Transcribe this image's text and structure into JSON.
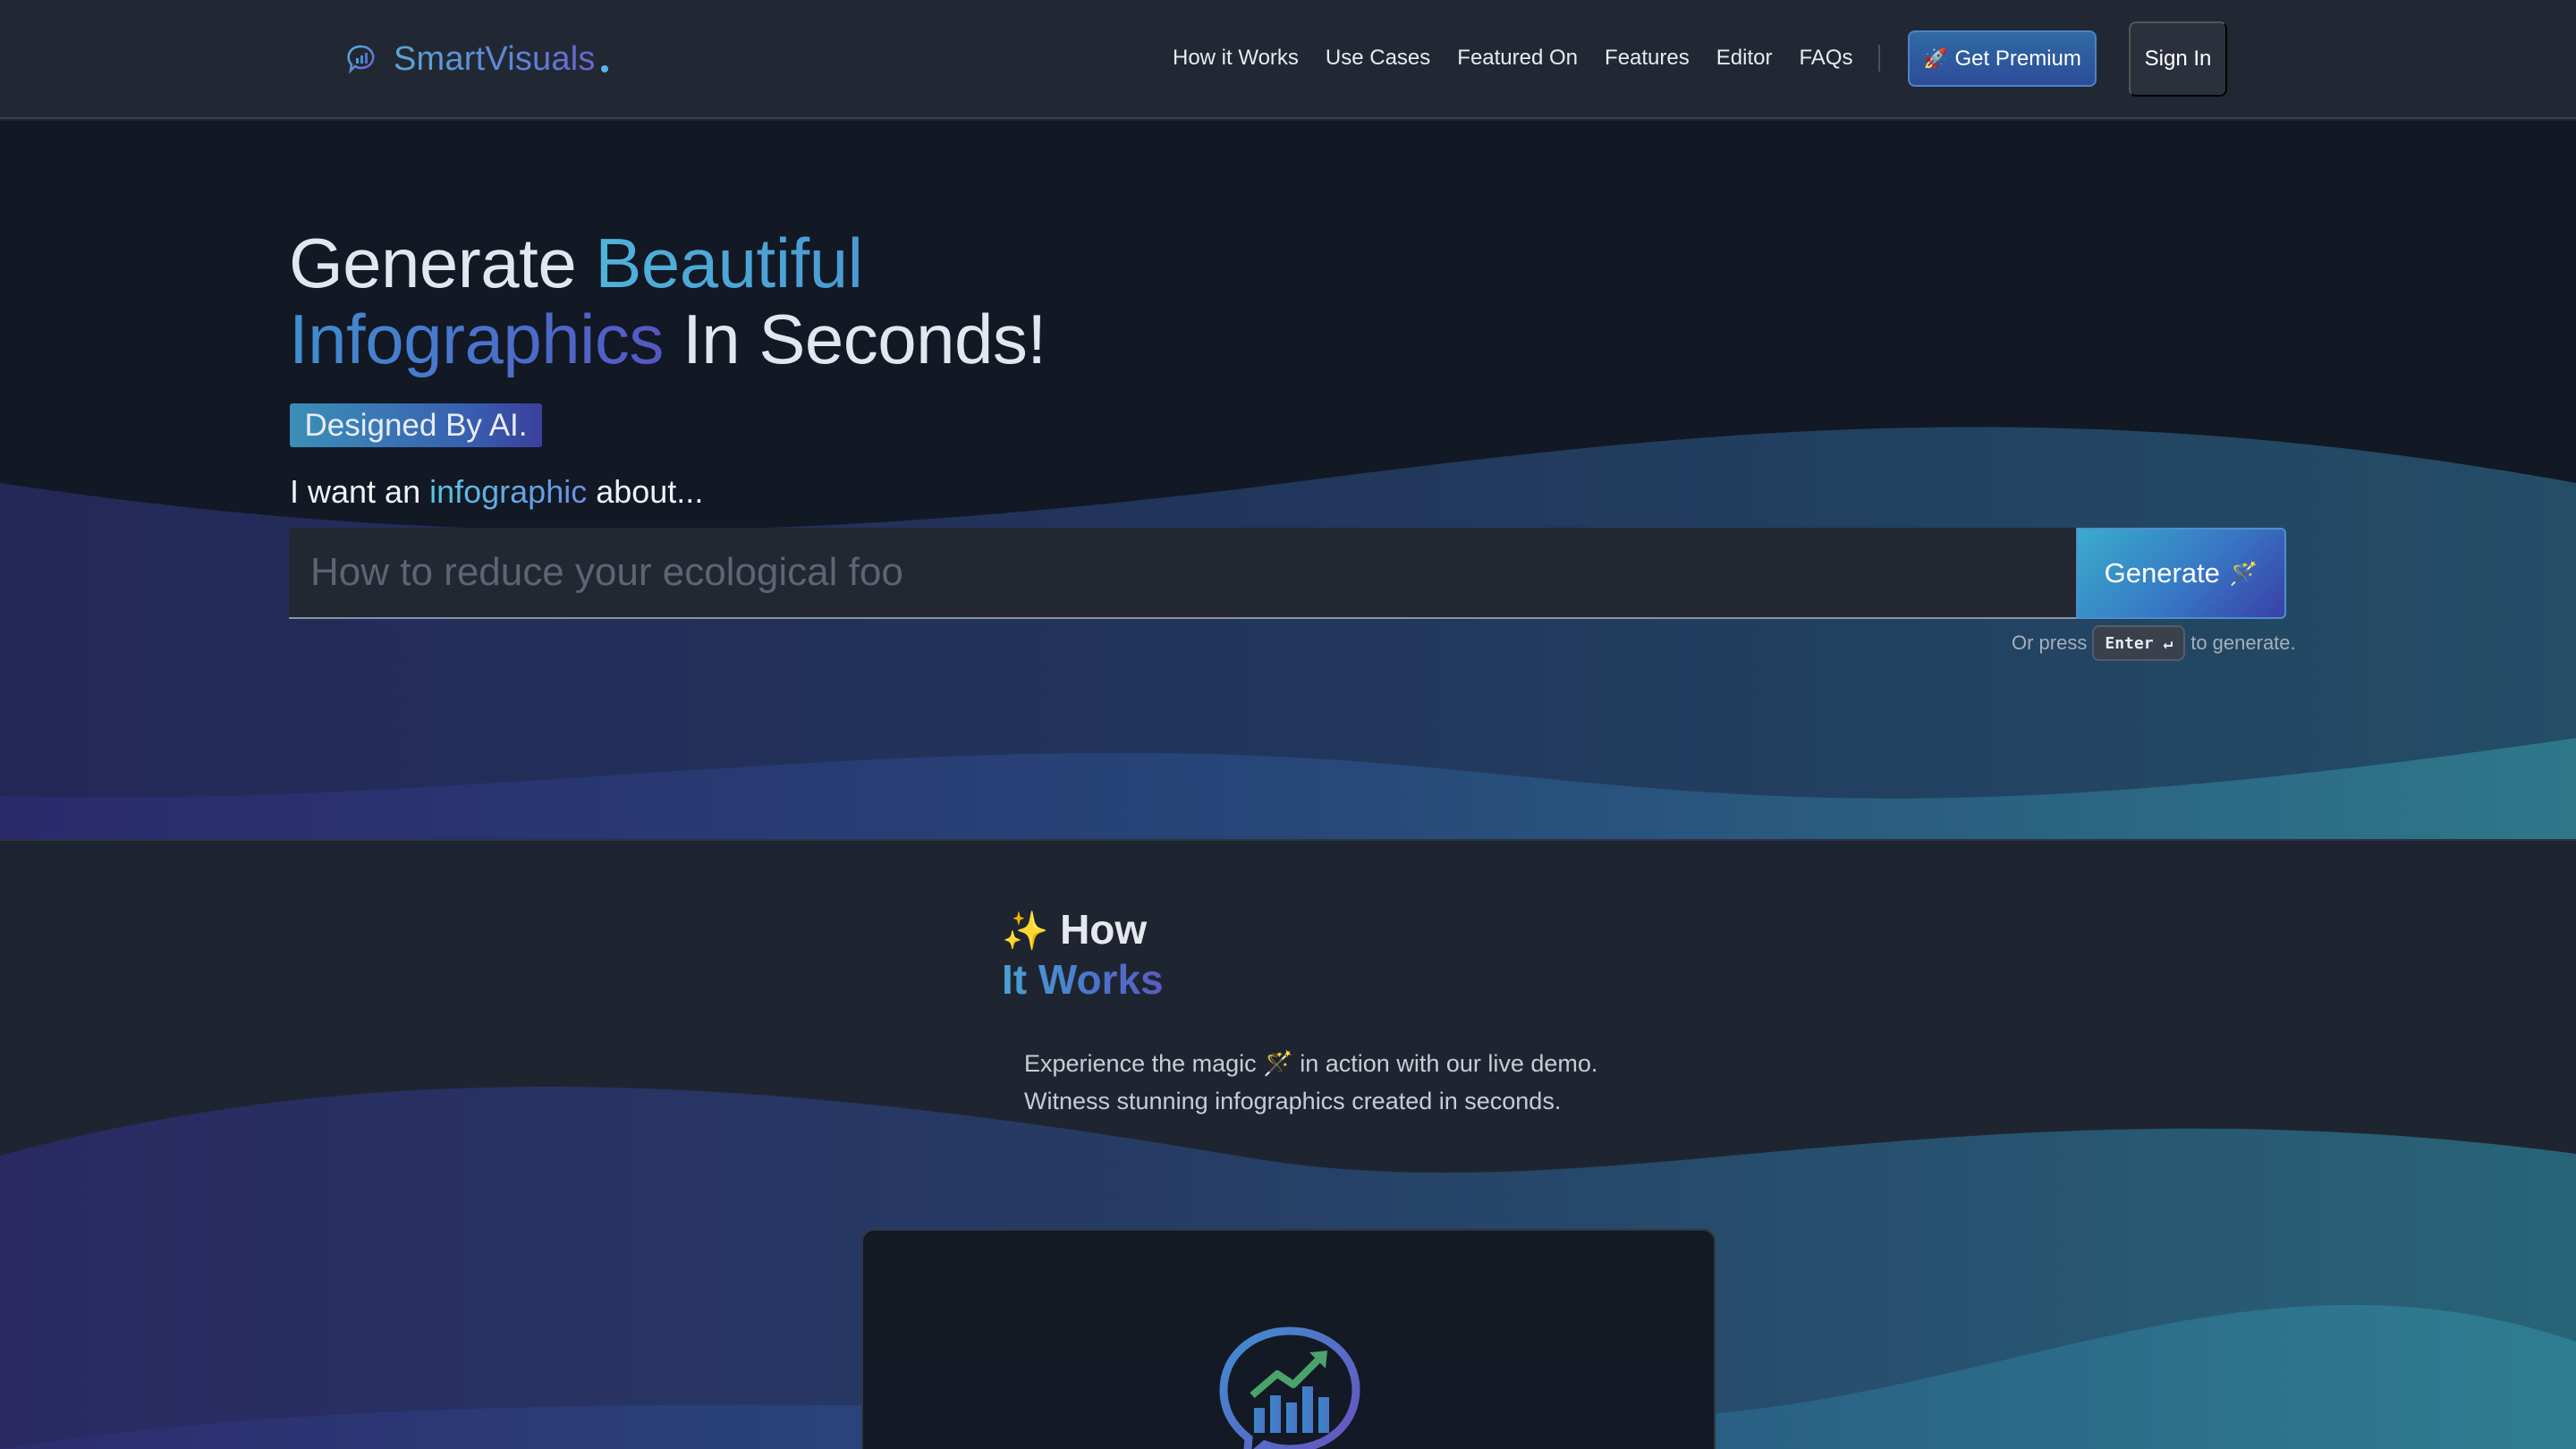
{
  "navbar": {
    "logo_text": "SmartVisuals",
    "links": [
      "How it Works",
      "Use Cases",
      "Featured On",
      "Features",
      "Editor",
      "FAQs"
    ],
    "premium_label": "Get Premium",
    "premium_icon": "rocket-icon",
    "signin_label": "Sign In"
  },
  "hero": {
    "title_part1": "Generate ",
    "title_highlight1": "Beautiful",
    "title_highlight2": "Infographics",
    "title_part2": " In Seconds!",
    "badge": "Designed By AI.",
    "prompt_prefix": "I want an ",
    "prompt_highlight": "infographic",
    "prompt_suffix": " about...",
    "input_placeholder": "How to reduce your ecological foo",
    "generate_label": "Generate",
    "generate_icon": "magic-wand-icon",
    "hint_prefix": "Or press",
    "hint_key": "Enter ↵",
    "hint_suffix": "to generate."
  },
  "how": {
    "title_line1": "How",
    "title_line2": "It Works",
    "sparkle_icon": "sparkles-icon",
    "desc_line1": "Experience the magic 🪄 in action with our live demo.",
    "desc_line2": "Witness stunning infographics created in seconds.",
    "demo_icon": "chart-chat-icon"
  },
  "colors": {
    "accent_cyan": "#4fb3d9",
    "accent_blue": "#3f8fd0",
    "accent_indigo": "#5457c4",
    "background": "#121824"
  }
}
